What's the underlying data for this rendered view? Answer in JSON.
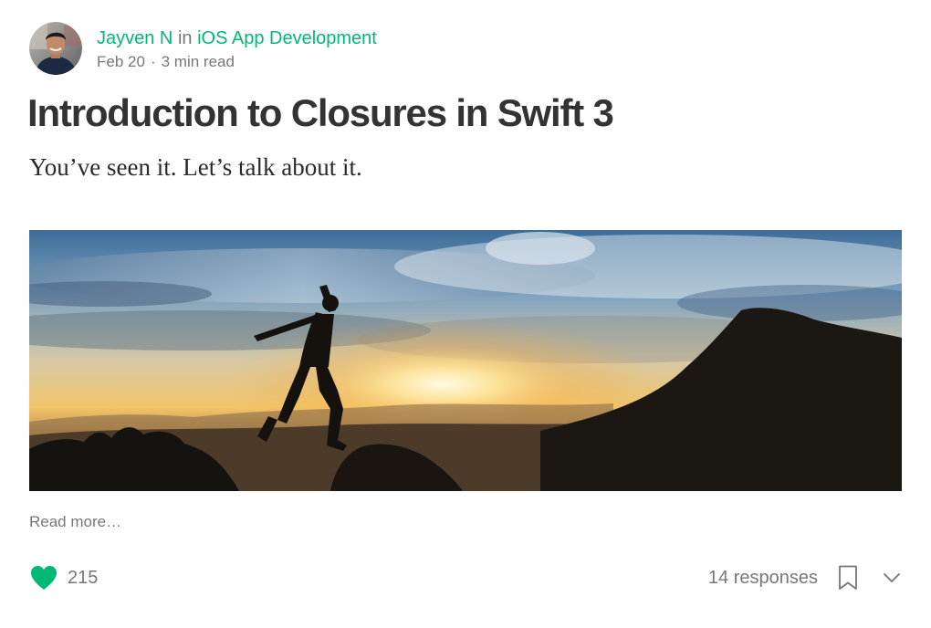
{
  "post": {
    "author": "Jayven N",
    "in_word": "in",
    "publication": "iOS App Development",
    "date": "Feb 20",
    "separator": "·",
    "read_time": "3 min read",
    "title": "Introduction to Closures in Swift 3",
    "subtitle": "You’ve seen it. Let’s talk about it.",
    "read_more": "Read more…"
  },
  "footer": {
    "clap_count": "215",
    "responses": "14 responses"
  },
  "colors": {
    "accent": "#02b875",
    "muted": "#757575"
  },
  "icons": {
    "heart": "heart-icon",
    "bookmark": "bookmark-icon",
    "more": "chevron-down-icon"
  }
}
